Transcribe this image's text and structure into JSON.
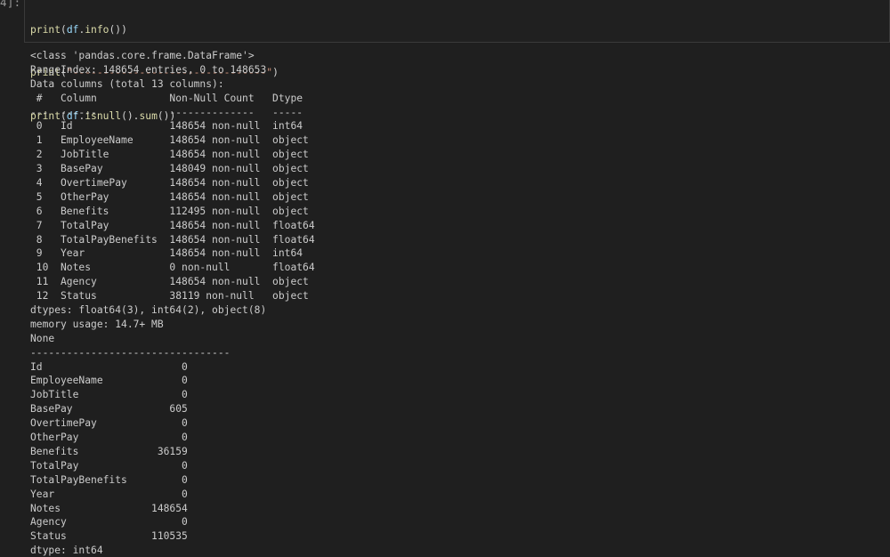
{
  "cell": {
    "prompt": "4]:",
    "code": {
      "line1": {
        "fn": "print",
        "open": "(",
        "obj": "df",
        "dot": ".",
        "meth": "info",
        "close": "())"
      },
      "line2": {
        "fn": "print",
        "open": "(",
        "str": "\"--------------------------------\"",
        "close": ")"
      },
      "line3": {
        "fn": "print",
        "open": "(",
        "obj": "df",
        "dot1": ".",
        "meth1": "isnull",
        "mid": "().",
        "meth2": "sum",
        "close": "())"
      }
    }
  },
  "output": {
    "lines": [
      "<class 'pandas.core.frame.DataFrame'>",
      "RangeIndex: 148654 entries, 0 to 148653",
      "Data columns (total 13 columns):",
      " #   Column            Non-Null Count   Dtype  ",
      "---  ------            --------------   -----  ",
      " 0   Id                148654 non-null  int64  ",
      " 1   EmployeeName      148654 non-null  object ",
      " 2   JobTitle          148654 non-null  object ",
      " 3   BasePay           148049 non-null  object ",
      " 4   OvertimePay       148654 non-null  object ",
      " 5   OtherPay          148654 non-null  object ",
      " 6   Benefits          112495 non-null  object ",
      " 7   TotalPay          148654 non-null  float64",
      " 8   TotalPayBenefits  148654 non-null  float64",
      " 9   Year              148654 non-null  int64  ",
      " 10  Notes             0 non-null       float64",
      " 11  Agency            148654 non-null  object ",
      " 12  Status            38119 non-null   object ",
      "dtypes: float64(3), int64(2), object(8)",
      "memory usage: 14.7+ MB",
      "None",
      "---------------------------------",
      "Id                       0",
      "EmployeeName             0",
      "JobTitle                 0",
      "BasePay                605",
      "OvertimePay              0",
      "OtherPay                 0",
      "Benefits             36159",
      "TotalPay                 0",
      "TotalPayBenefits         0",
      "Year                     0",
      "Notes               148654",
      "Agency                   0",
      "Status              110535",
      "dtype: int64"
    ]
  }
}
